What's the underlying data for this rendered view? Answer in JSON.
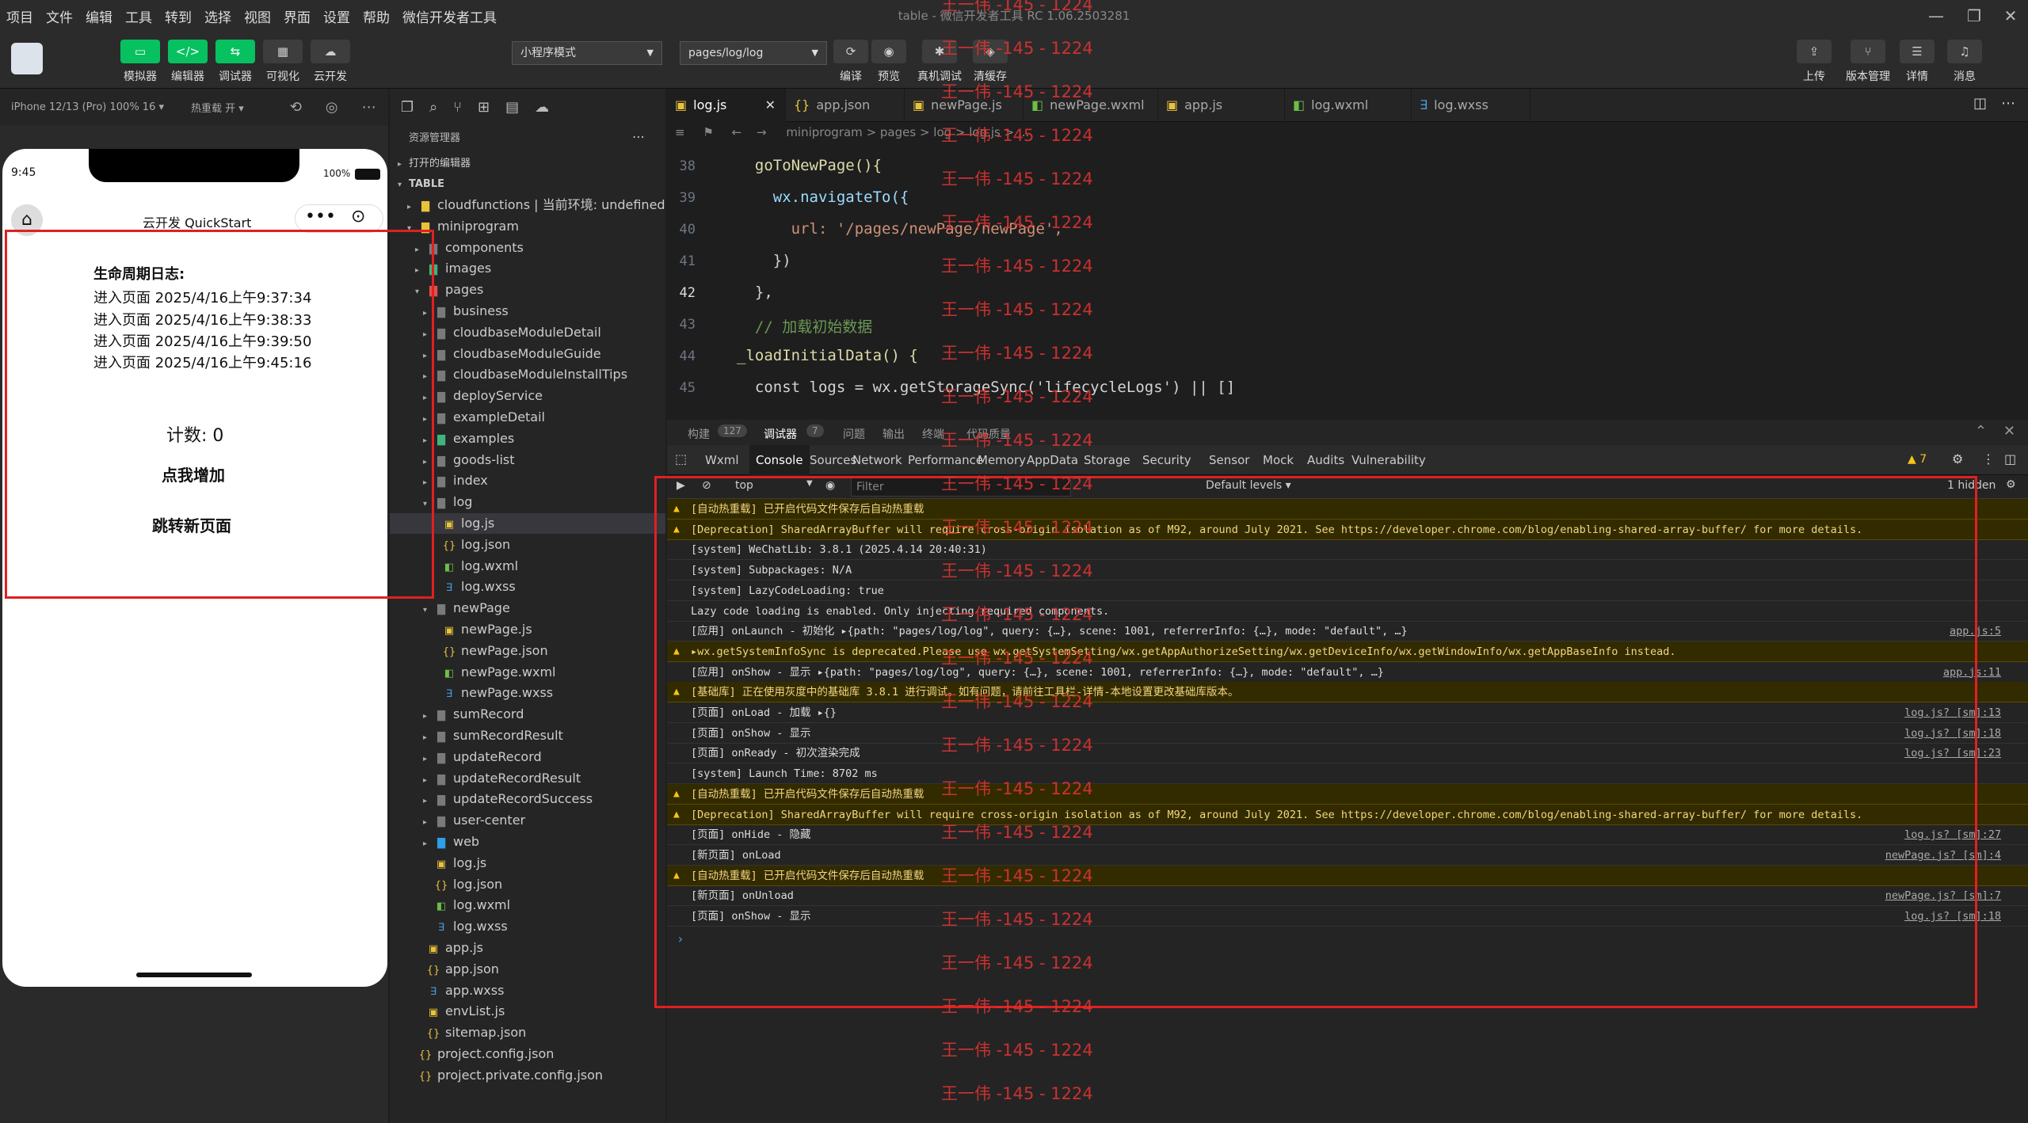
{
  "menu": [
    "项目",
    "文件",
    "编辑",
    "工具",
    "转到",
    "选择",
    "视图",
    "界面",
    "设置",
    "帮助",
    "微信开发者工具"
  ],
  "window_title": "table - 微信开发者工具 RC 1.06.2503281",
  "toolbar": {
    "left_buttons": [
      "模拟器",
      "编辑器",
      "调试器",
      "可视化",
      "云开发"
    ],
    "mode_select": "小程序模式",
    "page_select": "pages/log/log",
    "mid_buttons": [
      "编译",
      "预览",
      "真机调试",
      "清缓存"
    ],
    "right_buttons": [
      "上传",
      "版本管理",
      "详情",
      "消息"
    ]
  },
  "simulator": {
    "device": "iPhone 12/13 (Pro) 100% 16 ▾",
    "hot_reload": "热重载 开 ▾",
    "time": "9:45",
    "battery": "100%",
    "nav_title": "云开发 QuickStart",
    "log_title": "生命周期日志:",
    "logs": [
      "进入页面 2025/4/16上午9:37:34",
      "进入页面 2025/4/16上午9:38:33",
      "进入页面 2025/4/16上午9:39:50",
      "进入页面 2025/4/16上午9:45:16"
    ],
    "count_label": "计数: 0",
    "increment_button": "点我增加",
    "navigate_button": "跳转新页面"
  },
  "explorer": {
    "title": "资源管理器",
    "open_editors": "打开的编辑器",
    "root": "TABLE",
    "items": [
      {
        "label": "cloudfunctions | 当前环境: undefined",
        "kind": "folder",
        "indent": 1,
        "expanded": false
      },
      {
        "label": "miniprogram",
        "kind": "folder",
        "indent": 1,
        "expanded": true
      },
      {
        "label": "components",
        "kind": "folder",
        "indent": 2,
        "expanded": false
      },
      {
        "label": "images",
        "kind": "folder",
        "indent": 2,
        "expanded": false
      },
      {
        "label": "pages",
        "kind": "folder",
        "indent": 2,
        "expanded": true
      },
      {
        "label": "business",
        "kind": "folder",
        "indent": 3,
        "expanded": false
      },
      {
        "label": "cloudbaseModuleDetail",
        "kind": "folder",
        "indent": 3,
        "expanded": false
      },
      {
        "label": "cloudbaseModuleGuide",
        "kind": "folder",
        "indent": 3,
        "expanded": false
      },
      {
        "label": "cloudbaseModuleInstallTips",
        "kind": "folder",
        "indent": 3,
        "expanded": false
      },
      {
        "label": "deployService",
        "kind": "folder",
        "indent": 3,
        "expanded": false
      },
      {
        "label": "exampleDetail",
        "kind": "folder",
        "indent": 3,
        "expanded": false
      },
      {
        "label": "examples",
        "kind": "folder",
        "indent": 3,
        "expanded": false
      },
      {
        "label": "goods-list",
        "kind": "folder",
        "indent": 3,
        "expanded": false
      },
      {
        "label": "index",
        "kind": "folder",
        "indent": 3,
        "expanded": false
      },
      {
        "label": "log",
        "kind": "folder",
        "indent": 3,
        "expanded": true
      },
      {
        "label": "log.js",
        "kind": "js",
        "indent": 4,
        "selected": true
      },
      {
        "label": "log.json",
        "kind": "json",
        "indent": 4
      },
      {
        "label": "log.wxml",
        "kind": "wxml",
        "indent": 4
      },
      {
        "label": "log.wxss",
        "kind": "wxss",
        "indent": 4
      },
      {
        "label": "newPage",
        "kind": "folder",
        "indent": 3,
        "expanded": true
      },
      {
        "label": "newPage.js",
        "kind": "js",
        "indent": 4
      },
      {
        "label": "newPage.json",
        "kind": "json",
        "indent": 4
      },
      {
        "label": "newPage.wxml",
        "kind": "wxml",
        "indent": 4
      },
      {
        "label": "newPage.wxss",
        "kind": "wxss",
        "indent": 4
      },
      {
        "label": "sumRecord",
        "kind": "folder",
        "indent": 3,
        "expanded": false
      },
      {
        "label": "sumRecordResult",
        "kind": "folder",
        "indent": 3,
        "expanded": false
      },
      {
        "label": "updateRecord",
        "kind": "folder",
        "indent": 3,
        "expanded": false
      },
      {
        "label": "updateRecordResult",
        "kind": "folder",
        "indent": 3,
        "expanded": false
      },
      {
        "label": "updateRecordSuccess",
        "kind": "folder",
        "indent": 3,
        "expanded": false
      },
      {
        "label": "user-center",
        "kind": "folder",
        "indent": 3,
        "expanded": false
      },
      {
        "label": "web",
        "kind": "folder",
        "indent": 3,
        "expanded": false
      },
      {
        "label": "log.js",
        "kind": "js",
        "indent": 3
      },
      {
        "label": "log.json",
        "kind": "json",
        "indent": 3
      },
      {
        "label": "log.wxml",
        "kind": "wxml",
        "indent": 3
      },
      {
        "label": "log.wxss",
        "kind": "wxss",
        "indent": 3
      },
      {
        "label": "app.js",
        "kind": "js",
        "indent": 2
      },
      {
        "label": "app.json",
        "kind": "json",
        "indent": 2
      },
      {
        "label": "app.wxss",
        "kind": "wxss",
        "indent": 2
      },
      {
        "label": "envList.js",
        "kind": "js",
        "indent": 2
      },
      {
        "label": "sitemap.json",
        "kind": "json",
        "indent": 2
      },
      {
        "label": "project.config.json",
        "kind": "json",
        "indent": 1
      },
      {
        "label": "project.private.config.json",
        "kind": "json",
        "indent": 1
      }
    ]
  },
  "editor_tabs": [
    {
      "label": "log.js",
      "kind": "js",
      "active": true
    },
    {
      "label": "app.json",
      "kind": "json"
    },
    {
      "label": "newPage.js",
      "kind": "js"
    },
    {
      "label": "newPage.wxml",
      "kind": "wxml"
    },
    {
      "label": "app.js",
      "kind": "js"
    },
    {
      "label": "log.wxml",
      "kind": "wxml"
    },
    {
      "label": "log.wxss",
      "kind": "wxss"
    }
  ],
  "breadcrumb": "miniprogram > pages > log > log.js > ...",
  "code_lines": [
    {
      "n": "38",
      "text": "  goToNewPage(){"
    },
    {
      "n": "39",
      "text": "    wx.navigateTo({"
    },
    {
      "n": "40",
      "text": "      url: '/pages/newPage/newPage',"
    },
    {
      "n": "41",
      "text": "    })"
    },
    {
      "n": "42",
      "text": "  },"
    },
    {
      "n": "43",
      "text": "  // 加载初始数据"
    },
    {
      "n": "44",
      "text": "_loadInitialData() {"
    },
    {
      "n": "45",
      "text": "  const logs = wx.getStorageSync('lifecycleLogs') || []"
    }
  ],
  "panel": {
    "tabs": [
      "构建",
      "127",
      "调试器",
      "7",
      "问题",
      "输出",
      "终端",
      "代码质量"
    ],
    "devtools_tabs": [
      "Wxml",
      "Console",
      "Sources",
      "Network",
      "Performance",
      "Memory",
      "AppData",
      "Storage",
      "Security",
      "Sensor",
      "Mock",
      "Audits",
      "Vulnerability"
    ],
    "warning_count": "7",
    "context": "top",
    "filter_placeholder": "Filter",
    "levels": "Default levels ▾",
    "hidden": "1 hidden"
  },
  "console": [
    {
      "warn": true,
      "text": "[自动热重载] 已开启代码文件保存后自动热重载",
      "src": ""
    },
    {
      "warn": true,
      "text": "[Deprecation] SharedArrayBuffer will require cross-origin isolation as of M92, around July 2021. See https://developer.chrome.com/blog/enabling-shared-array-buffer/ for more details.",
      "src": ""
    },
    {
      "warn": false,
      "text": "[system] WeChatLib: 3.8.1 (2025.4.14 20:40:31)",
      "src": ""
    },
    {
      "warn": false,
      "text": "[system] Subpackages: N/A",
      "src": ""
    },
    {
      "warn": false,
      "text": "[system] LazyCodeLoading: true",
      "src": ""
    },
    {
      "warn": false,
      "text": "Lazy code loading is enabled. Only injecting required components.",
      "src": ""
    },
    {
      "warn": false,
      "text": "[应用] onLaunch - 初始化 ▸{path: \"pages/log/log\", query: {…}, scene: 1001, referrerInfo: {…}, mode: \"default\", …}",
      "src": "app.js:5"
    },
    {
      "warn": true,
      "text": "▸wx.getSystemInfoSync is deprecated.Please use wx.getSystemSetting/wx.getAppAuthorizeSetting/wx.getDeviceInfo/wx.getWindowInfo/wx.getAppBaseInfo instead.",
      "src": ""
    },
    {
      "warn": false,
      "text": "[应用] onShow - 显示 ▸{path: \"pages/log/log\", query: {…}, scene: 1001, referrerInfo: {…}, mode: \"default\", …}",
      "src": "app.js:11"
    },
    {
      "warn": true,
      "text": "[基础库] 正在使用灰度中的基础库 3.8.1 进行调试。如有问题，请前往工具栏-详情-本地设置更改基础库版本。",
      "src": ""
    },
    {
      "warn": false,
      "text": "[页面] onLoad - 加载 ▸{}",
      "src": "log.js? [sm]:13"
    },
    {
      "warn": false,
      "text": "[页面] onShow - 显示",
      "src": "log.js? [sm]:18"
    },
    {
      "warn": false,
      "text": "[页面] onReady - 初次渲染完成",
      "src": "log.js? [sm]:23"
    },
    {
      "warn": false,
      "text": "[system] Launch Time: 8702 ms",
      "src": ""
    },
    {
      "warn": true,
      "text": "[自动热重载] 已开启代码文件保存后自动热重载",
      "src": ""
    },
    {
      "warn": true,
      "text": "[Deprecation] SharedArrayBuffer will require cross-origin isolation as of M92, around July 2021. See https://developer.chrome.com/blog/enabling-shared-array-buffer/ for more details.",
      "src": ""
    },
    {
      "warn": false,
      "text": "[页面] onHide - 隐藏",
      "src": "log.js? [sm]:27"
    },
    {
      "warn": false,
      "text": "[新页面] onLoad",
      "src": "newPage.js? [sm]:4"
    },
    {
      "warn": true,
      "text": "[自动热重载] 已开启代码文件保存后自动热重载",
      "src": ""
    },
    {
      "warn": false,
      "text": "[新页面] onUnload",
      "src": "newPage.js? [sm]:7"
    },
    {
      "warn": false,
      "text": "[页面] onShow - 显示",
      "src": "log.js? [sm]:18"
    }
  ],
  "watermark": "王一伟 -145 - 1224"
}
